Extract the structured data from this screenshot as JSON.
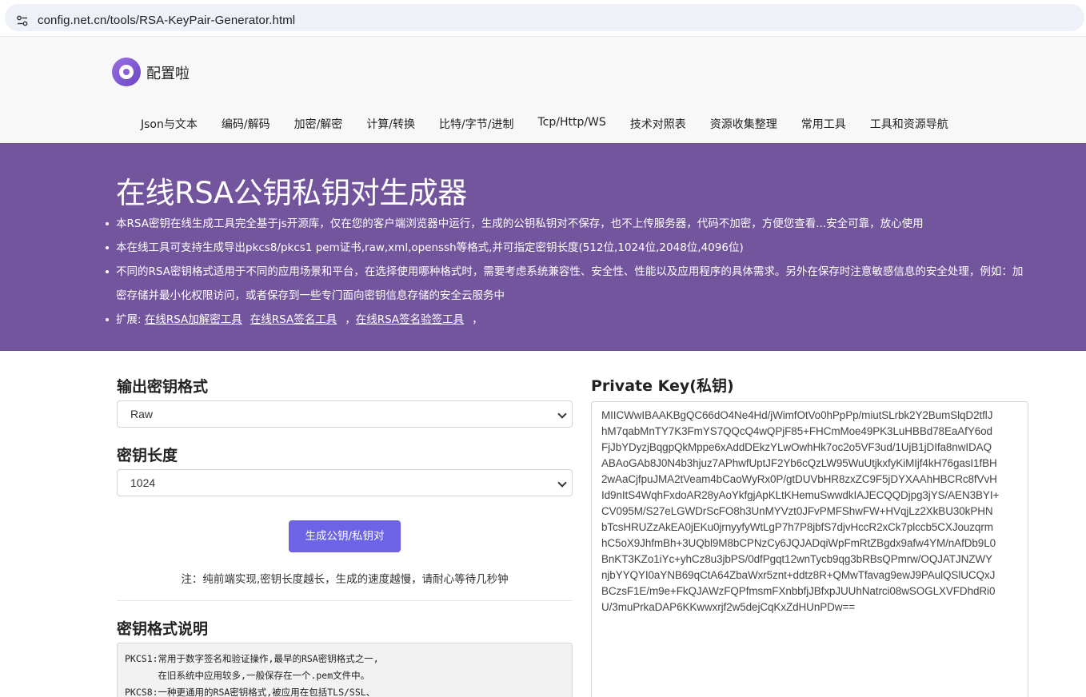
{
  "browser": {
    "url": "config.net.cn/tools/RSA-KeyPair-Generator.html"
  },
  "site": {
    "name": "配置啦"
  },
  "nav": [
    "Json与文本",
    "编码/解码",
    "加密/解密",
    "计算/转换",
    "比特/字节/进制",
    "Tcp/Http/WS",
    "技术对照表",
    "资源收集整理",
    "常用工具",
    "工具和资源导航"
  ],
  "hero": {
    "title": "在线RSA公钥私钥对生成器",
    "bullets": [
      "本RSA密钥在线生成工具完全基于js开源库，仅在您的客户端浏览器中运行，生成的公钥私钥对不保存，也不上传服务器，代码不加密，方便您查看...安全可靠，放心使用",
      "本在线工具可支持生成导出pkcs8/pkcs1 pem证书,raw,xml,openssh等格式,并可指定密钥长度(512位,1024位,2048位,4096位)",
      "不同的RSA密钥格式适用于不同的应用场景和平台，在选择使用哪种格式时，需要考虑系统兼容性、安全性、性能以及应用程序的具体需求。另外在保存时注意敏感信息的安全处理，例如：加密存储并最小化权限访问，或者保存到一些专门面向密钥信息存储的安全云服务中"
    ],
    "extend_label": "扩展:",
    "links": [
      "在线RSA加解密工具",
      "在线RSA签名工具",
      "在线RSA签名验签工具"
    ],
    "link_separator": "，"
  },
  "form": {
    "format_title": "输出密钥格式",
    "format_value": "Raw",
    "length_title": "密钥长度",
    "length_value": "1024",
    "generate_label": "生成公钥/私钥对",
    "note": "注：纯前端实现,密钥长度越长，生成的速度越慢，请耐心等待几秒钟",
    "format_desc_title": "密钥格式说明",
    "format_desc_lines": [
      "PKCS1:常用于数字签名和验证操作,最早的RSA密钥格式之一,",
      "      在旧系统中应用较多,一般保存在一个.pem文件中。",
      "PKCS8:一种更通用的RSA密钥格式,被应用在包括TLS/SSL、"
    ]
  },
  "private_key": {
    "title": "Private Key(私钥)",
    "lines": [
      "MIICWwIBAAKBgQC66dO4Ne4Hd/jWimfOtVo0hPpPp/miutSLrbk2Y2BumSlqD2tflJ",
      "hM7qabMnTY7K3FmYS7QQcQ4wQPjF85+FHCmMoe49PK3LuHBBd78EaAfY6od",
      "FjJbYDyzjBqgpQkMppe6xAddDEkzYLwOwhHk7oc2o5VF3ud/1UjB1jDIfa8nwIDAQ",
      "ABAoGAb8J0N4b3hjuz7APhwfUptJF2Yb6cQzLW95WuUtjkxfyKiMIjf4kH76gasI1fBH",
      "2wAaCjfpuJMA2tVeam4bCaoWyRx0P/gtDUVbHR8zxZC9F5jDYXAAhHBCRc8fVvH",
      "Id9nItS4WqhFxdoAR28yAoYkfgjApKLtKHemuSwwdkIAJECQQDjpg3jYS/AEN3BYI+",
      "CV095M/S27eLGWDrScFO8h3UnMYVzt0JFvPMFShwFW+HVqjLz2XkBU30kPHN",
      "bTcsHRUZzAkEA0jEKu0jrnyyfyWtLgP7h7P8jbfS7djvHccR2xCk7plccb5CXJouzqrm",
      "hC5oX9JhfmBh+3UQbl9M8bCPNzCy6JQJADqiWpFmRtZBgdx9afw4YM/nAfDb9L0",
      "BnKT3KZo1iYc+yhCz8u3jbPS/0dfPgqt12wnTycb9qg3bRBsQPmrw/OQJATJNZWY",
      "njbYYQYI0aYNB69qCtA64ZbaWxr5znt+ddtz8R+QMwTfavag9ewJ9PAulQSlUCQxJ",
      "BCzsF1E/m9e+FkQJAWzFQPfmsmFXnbbfjJBfxpJUUhNatrci08wSOGLXVFDhdRi0",
      "U/3muPrkaDAP6KKwwxrjf2w5dejCqKxZdHUnPDw=="
    ]
  }
}
